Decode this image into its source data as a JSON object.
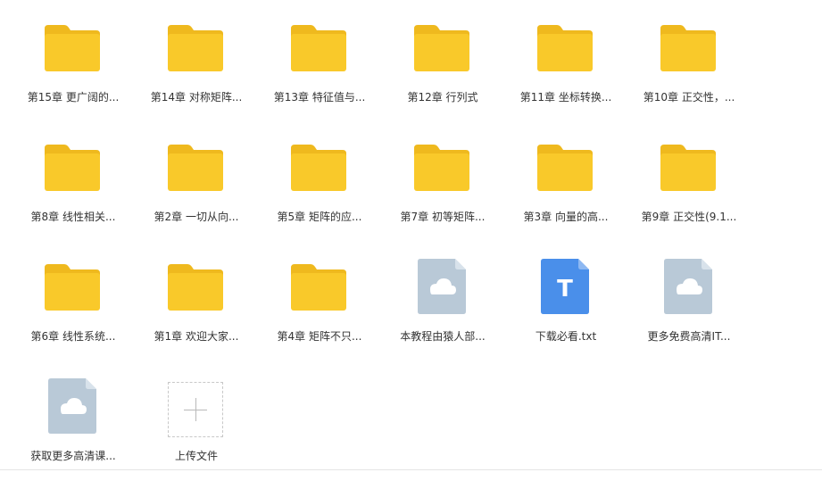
{
  "files": [
    {
      "name": "第15章 更广阔的...",
      "type": "folder"
    },
    {
      "name": "第14章 对称矩阵...",
      "type": "folder"
    },
    {
      "name": "第13章 特征值与...",
      "type": "folder"
    },
    {
      "name": "第12章 行列式",
      "type": "folder"
    },
    {
      "name": "第11章 坐标转换...",
      "type": "folder"
    },
    {
      "name": "第10章 正交性，...",
      "type": "folder"
    },
    {
      "name": "第8章 线性相关...",
      "type": "folder"
    },
    {
      "name": "第2章 一切从向...",
      "type": "folder"
    },
    {
      "name": "第5章 矩阵的应...",
      "type": "folder"
    },
    {
      "name": "第7章 初等矩阵...",
      "type": "folder"
    },
    {
      "name": "第3章 向量的高...",
      "type": "folder"
    },
    {
      "name": "第9章 正交性(9.1...",
      "type": "folder"
    },
    {
      "name": "第6章 线性系统...",
      "type": "folder"
    },
    {
      "name": "第1章 欢迎大家...",
      "type": "folder"
    },
    {
      "name": "第4章 矩阵不只...",
      "type": "folder"
    },
    {
      "name": "本教程由猿人部...",
      "type": "cloud-file"
    },
    {
      "name": "下载必看.txt",
      "type": "text-file",
      "glyph": "T"
    },
    {
      "name": "更多免费高清IT...",
      "type": "cloud-file"
    },
    {
      "name": "获取更多高清课...",
      "type": "cloud-file"
    }
  ],
  "upload": {
    "label": "上传文件"
  },
  "colors": {
    "folder": "#F9C92A",
    "folder_tab": "#EFB91E",
    "cloud_file": "#B9C9D7",
    "text_file": "#4A8FEA"
  }
}
